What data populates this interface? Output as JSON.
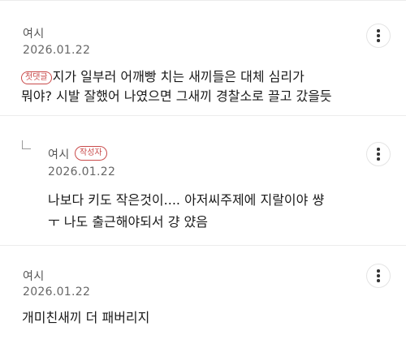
{
  "comments": [
    {
      "author": "여시",
      "date": "2026.01.22",
      "badge": "첫댓글",
      "lines": [
        "지가 일부러 어깨빵 치는 새끼들은 대체 심리가",
        "뭐야? 시발 잘했어 나였으면 그새끼 경찰소로 끌고 갔을듯"
      ],
      "more_icon": "more-vertical-icon"
    },
    {
      "author": "여시",
      "author_badge": "작성자",
      "date": "2026.01.22",
      "is_reply": true,
      "reply_icon": "reply-arrow-icon",
      "lines": [
        "나보다 키도 작은것이.... 아저씨주제에 지랄이야 썅",
        "ㅜ 나도 출근해야되서 걍 얐음"
      ],
      "more_icon": "more-vertical-icon"
    },
    {
      "author": "여시",
      "date": "2026.01.22",
      "lines": [
        "개미친새끼 더 패버리지"
      ],
      "more_icon": "more-vertical-icon"
    }
  ],
  "colors": {
    "badge": "#c94b4b",
    "divider": "#ececec",
    "text": "#1a1a1a",
    "meta": "#666666"
  }
}
